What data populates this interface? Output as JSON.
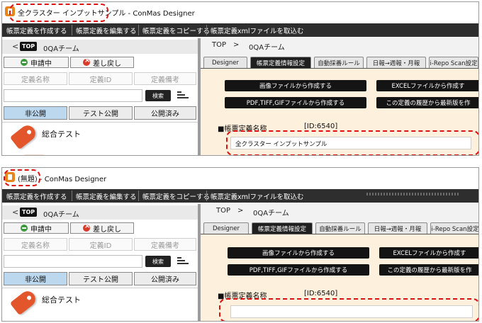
{
  "shots": [
    {
      "title": "全クラスター インプットサンプル - ConMas Designer",
      "input_value": "全クラスター インプットサンプル"
    },
    {
      "title": "(無題) - ConMas Designer",
      "input_value": ""
    }
  ],
  "menu": [
    "帳票定義を作成する",
    "帳票定義を編集する",
    "帳票定義をコピーする",
    "帳票定義xmlファイルを取込む"
  ],
  "left": {
    "back": "<",
    "top_badge": "TOP",
    "team": "0QAチーム",
    "status_pending": "申請中",
    "status_reject": "差し戻し",
    "columns": [
      "定義名称",
      "定義ID",
      "定義備考"
    ],
    "search_button": "検索",
    "pub_tabs": [
      "非公開",
      "テスト公開",
      "公開済み"
    ],
    "list_item": "総合テスト"
  },
  "right": {
    "crumb_top": "TOP",
    "crumb_sep": ">",
    "crumb_team": "0QAチーム",
    "tabs": [
      "Designer",
      "帳票定義情報設定",
      "自動採番ルール",
      "日報→週報・月報",
      "i-Repo Scan設定"
    ],
    "btn_image": "画像ファイルから作成する",
    "btn_excel": "EXCELファイルから作成す",
    "btn_pdf": "PDF,TIFF,GIFファイルから作成する",
    "btn_history": "この定義の履歴から最新版を作",
    "section_title": "■帳票定義名称",
    "section_id": "[ID:6540]"
  },
  "colors": {
    "menubar": "#2e2e2e",
    "content_bg": "#fdf0dd",
    "active_tab": "#1f1f1f",
    "pub_active": "#bcd8ef",
    "highlight": "#e01010"
  }
}
